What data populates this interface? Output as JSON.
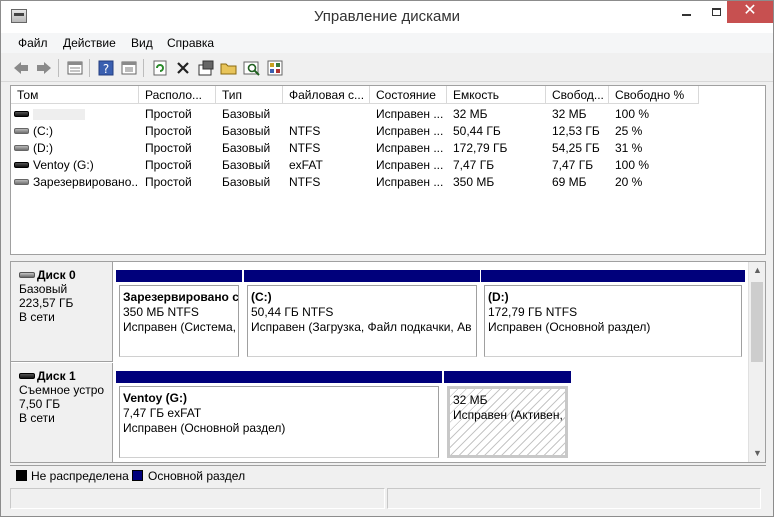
{
  "window": {
    "title": "Управление дисками",
    "min_label": "",
    "max_label": "",
    "close_label": "✕"
  },
  "menu": {
    "items": [
      {
        "label": "Файл"
      },
      {
        "label": "Действие"
      },
      {
        "label": "Вид"
      },
      {
        "label": "Справка"
      }
    ]
  },
  "toolbar": {
    "icons": [
      "back-icon",
      "forward-icon",
      "disk-list-icon",
      "help-icon",
      "properties-icon",
      "refresh-icon",
      "delete-icon",
      "rescan-icon",
      "open-folder-icon",
      "search-icon",
      "check-icon"
    ]
  },
  "volumes": {
    "columns": [
      "Том",
      "Располо...",
      "Тип",
      "Файловая с...",
      "Состояние",
      "Емкость",
      "Свобод...",
      "Свободно %"
    ],
    "rows": [
      {
        "name": "",
        "layout": "Простой",
        "type": "Базовый",
        "fs": "",
        "status": "Исправен ...",
        "capacity": "32 МБ",
        "free": "32 МБ",
        "free_pct": "100 %"
      },
      {
        "name": "(C:)",
        "layout": "Простой",
        "type": "Базовый",
        "fs": "NTFS",
        "status": "Исправен ...",
        "capacity": "50,44 ГБ",
        "free": "12,53 ГБ",
        "free_pct": "25 %"
      },
      {
        "name": "(D:)",
        "layout": "Простой",
        "type": "Базовый",
        "fs": "NTFS",
        "status": "Исправен ...",
        "capacity": "172,79 ГБ",
        "free": "54,25 ГБ",
        "free_pct": "31 %"
      },
      {
        "name": "Ventoy (G:)",
        "layout": "Простой",
        "type": "Базовый",
        "fs": "exFAT",
        "status": "Исправен ...",
        "capacity": "7,47 ГБ",
        "free": "7,47 ГБ",
        "free_pct": "100 %"
      },
      {
        "name": "Зарезервировано...",
        "layout": "Простой",
        "type": "Базовый",
        "fs": "NTFS",
        "status": "Исправен ...",
        "capacity": "350 МБ",
        "free": "69 МБ",
        "free_pct": "20 %"
      }
    ]
  },
  "disks": [
    {
      "title": "Диск 0",
      "kind": "Базовый",
      "size": "223,57 ГБ",
      "state": "В сети",
      "partitions": [
        {
          "name": "Зарезервировано с",
          "size_fs": "350 МБ NTFS",
          "status": "Исправен (Система, "
        },
        {
          "name": "(C:)",
          "size_fs": "50,44 ГБ NTFS",
          "status": "Исправен (Загрузка, Файл подкачки, Ав"
        },
        {
          "name": "(D:)",
          "size_fs": "172,79 ГБ NTFS",
          "status": "Исправен (Основной раздел)"
        }
      ]
    },
    {
      "title": "Диск 1",
      "kind": "Съемное устро",
      "size": "7,50 ГБ",
      "state": "В сети",
      "partitions": [
        {
          "name": "Ventoy  (G:)",
          "size_fs": "7,47 ГБ exFAT",
          "status": "Исправен (Основной раздел)"
        },
        {
          "name": "",
          "size_fs": "32 МБ",
          "status": "Исправен (Активен,"
        }
      ]
    }
  ],
  "legend": {
    "unallocated": "Не распределена",
    "primary": "Основной раздел",
    "unallocated_color": "#000000",
    "primary_color": "#00007b"
  },
  "scrollbar": {
    "up": "▲",
    "down": "▼"
  }
}
